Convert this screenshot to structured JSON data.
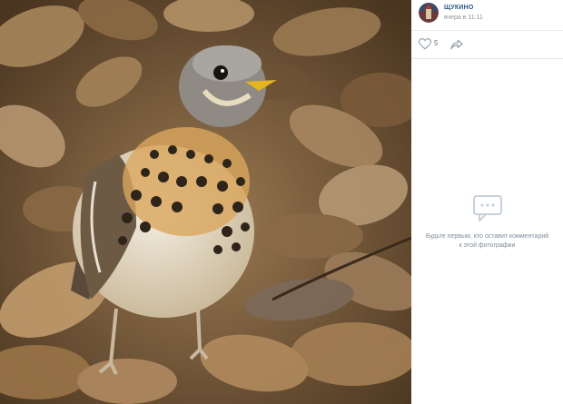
{
  "post": {
    "author": "ЩУКИНО",
    "date": "вчера в 11:11",
    "likes": "5"
  },
  "comments": {
    "empty_text": "Будьте первым, кто оставит комментарий к этой фотографии"
  },
  "icons": {
    "avatar": "avatar-icon",
    "like": "heart-icon",
    "share": "share-arrow-icon",
    "comments": "comment-bubble-icon"
  },
  "colors": {
    "author_link": "#2a5885",
    "muted_text": "#939393",
    "icon_gray": "#99a2ad"
  }
}
